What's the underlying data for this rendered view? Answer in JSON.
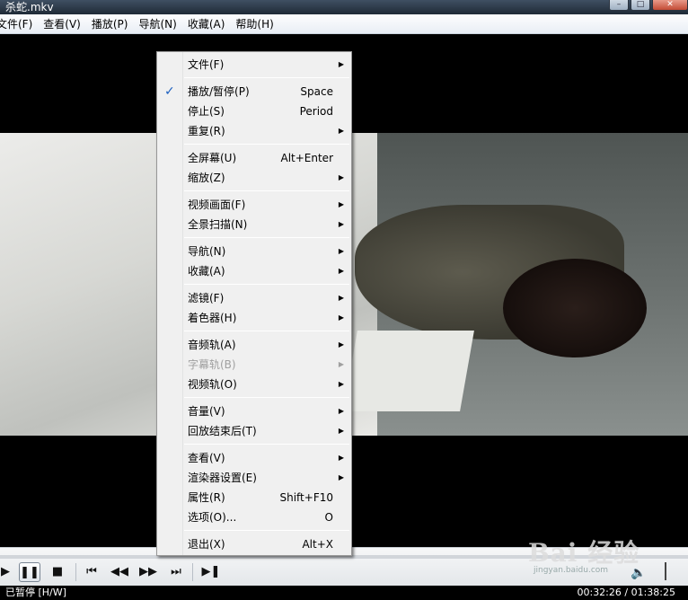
{
  "window": {
    "title": "杀蛇.mkv"
  },
  "menubar": [
    "文件(F)",
    "查看(V)",
    "播放(P)",
    "导航(N)",
    "收藏(A)",
    "帮助(H)"
  ],
  "context_menu": {
    "groups": [
      [
        {
          "label": "文件(F)",
          "submenu": true
        }
      ],
      [
        {
          "label": "播放/暂停(P)",
          "shortcut": "Space",
          "checked": true
        },
        {
          "label": "停止(S)",
          "shortcut": "Period"
        },
        {
          "label": "重复(R)",
          "submenu": true
        }
      ],
      [
        {
          "label": "全屏幕(U)",
          "shortcut": "Alt+Enter"
        },
        {
          "label": "缩放(Z)",
          "submenu": true
        }
      ],
      [
        {
          "label": "视频画面(F)",
          "submenu": true
        },
        {
          "label": "全景扫描(N)",
          "submenu": true
        }
      ],
      [
        {
          "label": "导航(N)",
          "submenu": true
        },
        {
          "label": "收藏(A)",
          "submenu": true
        }
      ],
      [
        {
          "label": "滤镜(F)",
          "submenu": true
        },
        {
          "label": "着色器(H)",
          "submenu": true
        }
      ],
      [
        {
          "label": "音频轨(A)",
          "submenu": true
        },
        {
          "label": "字幕轨(B)",
          "submenu": true,
          "disabled": true
        },
        {
          "label": "视频轨(O)",
          "submenu": true
        }
      ],
      [
        {
          "label": "音量(V)",
          "submenu": true
        },
        {
          "label": "回放结束后(T)",
          "submenu": true
        }
      ],
      [
        {
          "label": "查看(V)",
          "submenu": true
        },
        {
          "label": "渲染器设置(E)",
          "submenu": true
        },
        {
          "label": "属性(R)",
          "shortcut": "Shift+F10"
        },
        {
          "label": "选项(O)...",
          "shortcut": "O"
        }
      ],
      [
        {
          "label": "退出(X)",
          "shortcut": "Alt+X"
        }
      ]
    ]
  },
  "controls": {
    "buttons": [
      {
        "name": "play-button",
        "glyph": "▶"
      },
      {
        "name": "pause-button",
        "glyph": "❚❚"
      },
      {
        "name": "stop-button",
        "glyph": "■"
      },
      {
        "name": "previous-button",
        "glyph": "⏮"
      },
      {
        "name": "rewind-button",
        "glyph": "◀◀"
      },
      {
        "name": "fast-forward-button",
        "glyph": "▶▶"
      },
      {
        "name": "next-button",
        "glyph": "⏭"
      },
      {
        "name": "frame-step-button",
        "glyph": "▶❚"
      }
    ],
    "volume_icon": "speaker-icon"
  },
  "status": {
    "state": "已暂停 [H/W]",
    "time": "00:32:26 / 01:38:25"
  },
  "watermark": {
    "big": "Bai 经验",
    "small": "jingyan.baidu.com"
  }
}
